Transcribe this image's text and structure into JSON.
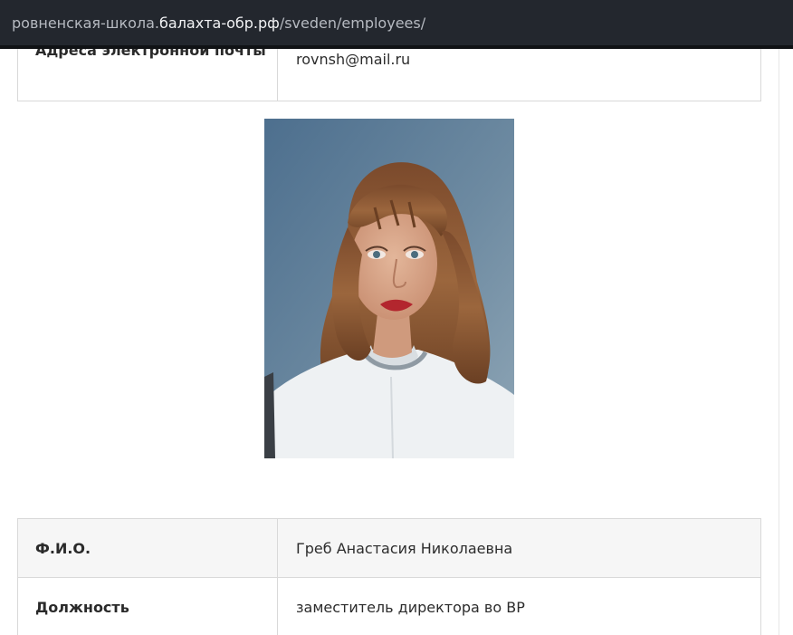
{
  "address_bar": {
    "prefix": "ровненская-школа.",
    "host": "балахта-обр.рф",
    "path": "/sveden/employees/"
  },
  "contact_table": {
    "email_label": "Адреса электронной почты",
    "email_value": "rovnsh@mail.ru"
  },
  "employee_table": {
    "rows": [
      {
        "label": "Ф.И.О.",
        "value": "Греб Анастасия Николаевна"
      },
      {
        "label": "Должность",
        "value": "заместитель директора во ВР"
      }
    ]
  },
  "colors": {
    "address_bar_bg": "#23272e",
    "table_border": "#d9d9d9",
    "row_shade": "#f6f6f6"
  }
}
